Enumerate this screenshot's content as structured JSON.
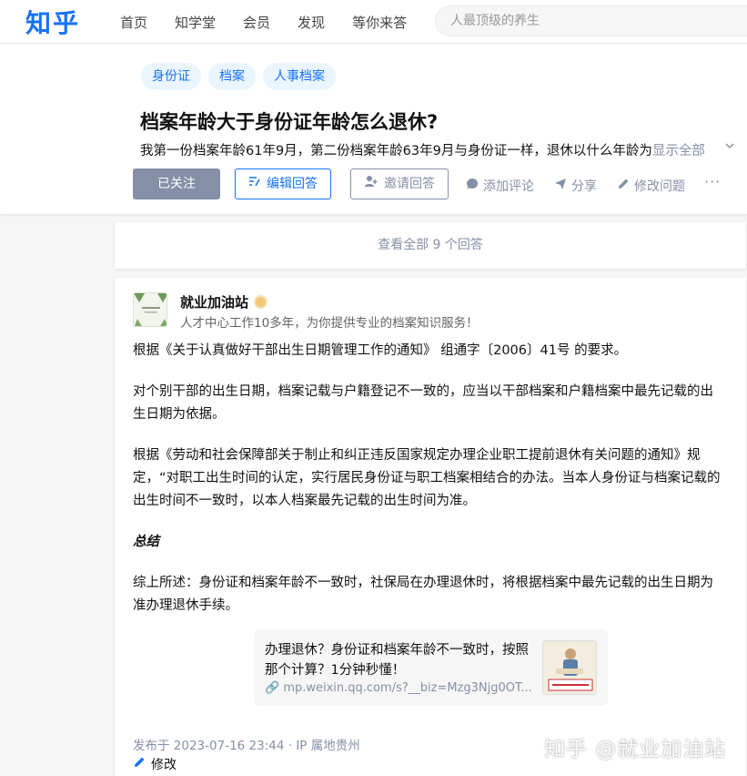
{
  "header": {
    "logo": "知乎",
    "nav": [
      "首页",
      "知学堂",
      "会员",
      "发现",
      "等你来答"
    ],
    "search_placeholder": "人最顶级的养生"
  },
  "question": {
    "tags": [
      "身份证",
      "档案",
      "人事档案"
    ],
    "title": "档案年龄大于身份证年龄怎么退休?",
    "description": "我第一份档案年龄61年9月，第二份档案年龄63年9月与身份证一样，退休以什么年龄为",
    "show_all": "显示全部",
    "follow_label": "已关注",
    "edit_answer_label": "编辑回答",
    "invite_label": "邀请回答",
    "comment_label": "添加评论",
    "share_label": "分享",
    "modify_label": "修改问题",
    "more_label": "···"
  },
  "view_all": "查看全部 9 个回答",
  "answer": {
    "author_name": "就业加油站",
    "author_bio": "人才中心工作10多年，为你提供专业的档案知识服务！",
    "paragraphs": [
      "根据《关于认真做好干部出生日期管理工作的通知》 组通字〔2006〕41号 的要求。",
      "对个别干部的出生日期，档案记载与户籍登记不一致的，应当以干部档案和户籍档案中最先记载的出生日期为依据。",
      "根据《劳动和社会保障部关于制止和纠正违反国家规定办理企业职工提前退休有关问题的通知》规定，“对职工出生时间的认定，实行居民身份证与职工档案相结合的办法。当本人身份证与档案记载的出生时间不一致时，以本人档案最先记载的出生时间为准。",
      "总结",
      "综上所述：身份证和档案年龄不一致时，社保局在办理退休时，将根据档案中最先记载的出生日期为准办理退休手续。"
    ],
    "link_card": {
      "title": "办理退休？身份证和档案年龄不一致时，按照那个计算？1分钟秒懂！",
      "url": "mp.weixin.qq.com/s?__biz=Mzg3Njg0OT..."
    },
    "meta": "发布于 2023-07-16 23:44 · IP 属地贵州",
    "edit_label": "修改"
  },
  "watermark": "知乎 @就业加油站",
  "colors": {
    "brand": "#1772f6",
    "muted": "#8590a6"
  }
}
